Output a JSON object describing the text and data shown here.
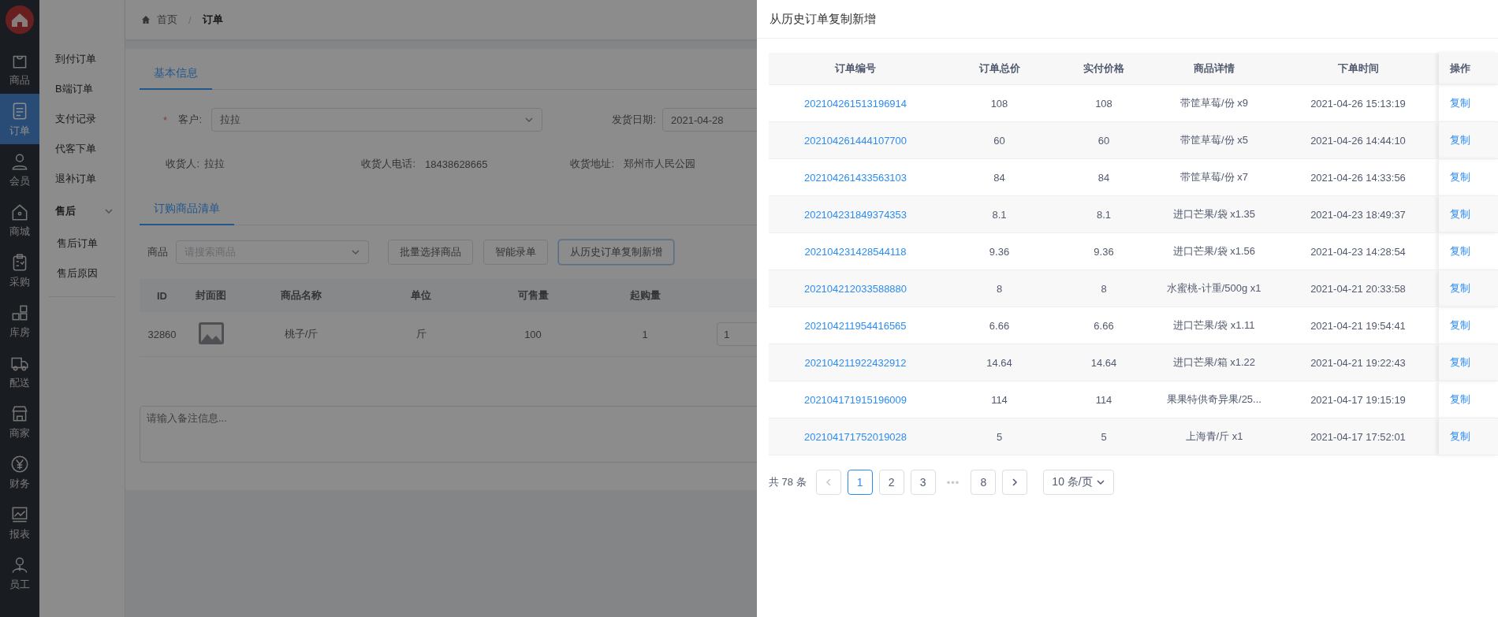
{
  "nav": [
    {
      "label": "商品",
      "selected": false
    },
    {
      "label": "订单",
      "selected": true
    },
    {
      "label": "会员",
      "selected": false
    },
    {
      "label": "商城",
      "selected": false
    },
    {
      "label": "采购",
      "selected": false
    },
    {
      "label": "库房",
      "selected": false
    },
    {
      "label": "配送",
      "selected": false
    },
    {
      "label": "商家",
      "selected": false
    },
    {
      "label": "财务",
      "selected": false
    },
    {
      "label": "报表",
      "selected": false
    },
    {
      "label": "员工",
      "selected": false
    }
  ],
  "submenu": [
    {
      "label": "到付订单",
      "kind": "item"
    },
    {
      "label": "B端订单",
      "kind": "item"
    },
    {
      "label": "支付记录",
      "kind": "item"
    },
    {
      "label": "代客下单",
      "kind": "item"
    },
    {
      "label": "退补订单",
      "kind": "item"
    },
    {
      "label": "售后",
      "kind": "group",
      "expanded": true,
      "children": [
        {
          "label": "售后订单"
        },
        {
          "label": "售后原因"
        }
      ]
    }
  ],
  "breadcrumb": [
    "首页",
    "订单"
  ],
  "breadcrumb_separator": "/",
  "basic_tab": {
    "label": "基本信息",
    "selected": true
  },
  "form": {
    "required_mark": "*",
    "customer_label": "客户:",
    "customer": "拉拉",
    "ship_date_label": "发货日期:",
    "ship_date": "2021-04-28",
    "receiver_label": "收货人:",
    "receiver": "拉拉",
    "phone_label": "收货人电话:",
    "phone": "18438628665",
    "address_label": "收货地址:",
    "address": "郑州市人民公园"
  },
  "goods_tab": {
    "label": "订购商品清单",
    "selected": true
  },
  "goods_toolbar": {
    "label": "商品",
    "placeholder": "请搜索商品",
    "buttons": [
      {
        "label": "批量选择商品",
        "focused": false
      },
      {
        "label": "智能录单",
        "focused": false
      },
      {
        "label": "从历史订单复制新增",
        "focused": true
      }
    ]
  },
  "goods_table": {
    "columns": [
      "ID",
      "封面图",
      "商品名称",
      "单位",
      "可售量",
      "起购量"
    ],
    "rows": [
      {
        "id": "32860",
        "name": "桃子/斤",
        "unit": "斤",
        "stock": "100",
        "min": "1",
        "qty": "1"
      }
    ]
  },
  "remark": {
    "placeholder": "请输入备注信息..."
  },
  "drawer": {
    "title": "从历史订单复制新增",
    "columns": [
      "订单编号",
      "订单总价",
      "实付价格",
      "商品详情",
      "下单时间",
      "操作"
    ],
    "rows": [
      {
        "order_no": "202104261513196914",
        "total": "108",
        "paid": "108",
        "detail": "带筐草莓/份 x9",
        "time": "2021-04-26 15:13:19",
        "action": "复制"
      },
      {
        "order_no": "202104261444107700",
        "total": "60",
        "paid": "60",
        "detail": "带筐草莓/份 x5",
        "time": "2021-04-26 14:44:10",
        "action": "复制"
      },
      {
        "order_no": "202104261433563103",
        "total": "84",
        "paid": "84",
        "detail": "带筐草莓/份 x7",
        "time": "2021-04-26 14:33:56",
        "action": "复制"
      },
      {
        "order_no": "202104231849374353",
        "total": "8.1",
        "paid": "8.1",
        "detail": "进口芒果/袋 x1.35",
        "time": "2021-04-23 18:49:37",
        "action": "复制"
      },
      {
        "order_no": "202104231428544118",
        "total": "9.36",
        "paid": "9.36",
        "detail": "进口芒果/袋 x1.56",
        "time": "2021-04-23 14:28:54",
        "action": "复制"
      },
      {
        "order_no": "202104212033588880",
        "total": "8",
        "paid": "8",
        "detail": "水蜜桃-计重/500g x1",
        "time": "2021-04-21 20:33:58",
        "action": "复制"
      },
      {
        "order_no": "202104211954416565",
        "total": "6.66",
        "paid": "6.66",
        "detail": "进口芒果/袋 x1.11",
        "time": "2021-04-21 19:54:41",
        "action": "复制"
      },
      {
        "order_no": "202104211922432912",
        "total": "14.64",
        "paid": "14.64",
        "detail": "进口芒果/箱 x1.22",
        "time": "2021-04-21 19:22:43",
        "action": "复制"
      },
      {
        "order_no": "202104171915196009",
        "total": "114",
        "paid": "114",
        "detail": "果果特供奇异果/25...",
        "time": "2021-04-17 19:15:19",
        "action": "复制"
      },
      {
        "order_no": "202104171752019028",
        "total": "5",
        "paid": "5",
        "detail": "上海青/斤 x1",
        "time": "2021-04-17 17:52:01",
        "action": "复制"
      }
    ],
    "pagination": {
      "total": "共 78 条",
      "pages": [
        {
          "label": "1",
          "kind": "page",
          "selected": true
        },
        {
          "label": "2",
          "kind": "page",
          "selected": false
        },
        {
          "label": "3",
          "kind": "page",
          "selected": false
        },
        {
          "label": "•••",
          "kind": "ellipsis",
          "selected": false
        },
        {
          "label": "8",
          "kind": "page",
          "selected": false
        }
      ],
      "prev_disabled": true,
      "page_size": "10 条/页"
    }
  }
}
